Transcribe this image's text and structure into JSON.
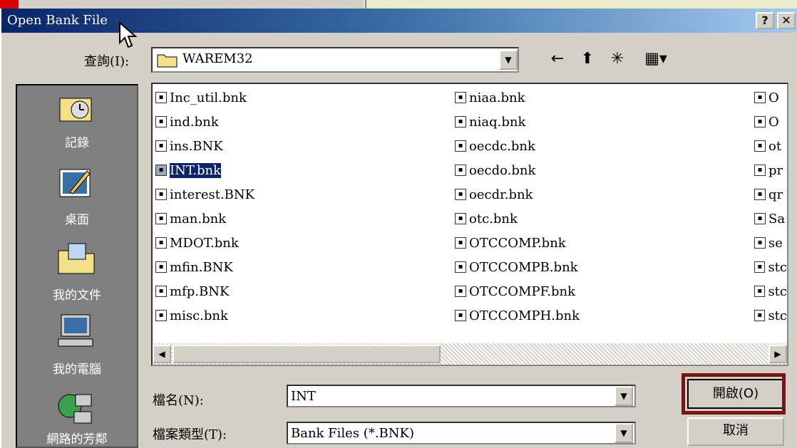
{
  "dialog": {
    "title": "Open Bank File",
    "help_label": "?",
    "close_label": "✕"
  },
  "toolbar": {
    "lookin_label": "查詢(I):",
    "lookin_value": "WAREM32",
    "back_icon": "←",
    "up_icon": "⬆",
    "newfolder_icon": "✳",
    "view_icon": "▦▾"
  },
  "places": [
    {
      "label": "記錄",
      "icon": "history-icon"
    },
    {
      "label": "桌面",
      "icon": "desktop-icon"
    },
    {
      "label": "我的文件",
      "icon": "my-documents-icon"
    },
    {
      "label": "我的電腦",
      "icon": "my-computer-icon"
    },
    {
      "label": "網路的芳鄰",
      "icon": "network-icon"
    }
  ],
  "files": {
    "col1": [
      "Inc_util.bnk",
      "ind.bnk",
      "ins.BNK",
      "INT.bnk",
      "interest.BNK",
      "man.bnk",
      "MDOT.bnk",
      "mfin.BNK",
      "mfp.BNK",
      "misc.bnk"
    ],
    "col2": [
      "niaa.bnk",
      "niaq.bnk",
      "oecdc.bnk",
      "oecdo.bnk",
      "oecdr.bnk",
      "otc.bnk",
      "OTCCOMP.bnk",
      "OTCCOMPB.bnk",
      "OTCCOMPF.bnk",
      "OTCCOMPH.bnk"
    ],
    "col3": [
      "O",
      "O",
      "ot",
      "pr",
      "qr",
      "Sa",
      "se",
      "stc",
      "stc",
      "stc"
    ],
    "selected": "INT.bnk"
  },
  "filename": {
    "label": "檔名(N):",
    "value": "INT"
  },
  "filetype": {
    "label": "檔案類型(T):",
    "value": "Bank Files (*.BNK)"
  },
  "buttons": {
    "open": "開啟(O)",
    "cancel": "取消"
  },
  "arrows": {
    "down": "▼",
    "left": "◀",
    "right": "▶"
  }
}
